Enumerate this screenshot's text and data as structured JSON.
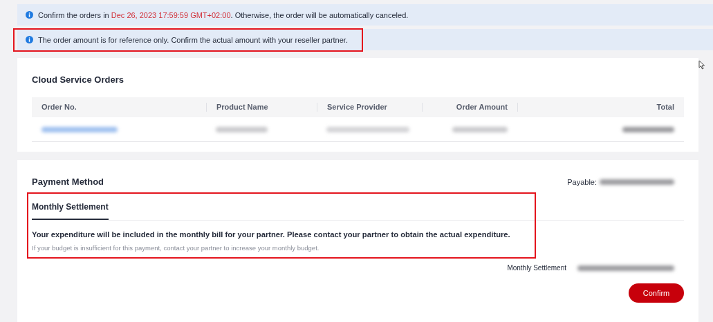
{
  "notices": [
    {
      "parts": [
        {
          "text": "Confirm the orders in ",
          "emphasis": false
        },
        {
          "text": "Dec 26, 2023 17:59:59 GMT+02:00",
          "emphasis": true
        },
        {
          "text": ". Otherwise, the order will be automatically canceled.",
          "emphasis": false
        }
      ],
      "highlighted": false
    },
    {
      "parts": [
        {
          "text": "The order amount is for reference only. Confirm the actual amount with your reseller partner.",
          "emphasis": false
        }
      ],
      "highlighted": true
    }
  ],
  "orders": {
    "title": "Cloud Service Orders",
    "columns": [
      "Order No.",
      "Product Name",
      "Service Provider",
      "Order Amount",
      "Total"
    ]
  },
  "payment": {
    "title": "Payment Method",
    "payable_label": "Payable:",
    "tabs": [
      {
        "label": "Monthly Settlement",
        "selected": true
      }
    ],
    "highlighted": true,
    "message": "Your expenditure will be included in the monthly bill for your partner. Please contact your partner to obtain the actual expenditure.",
    "hint": "If your budget is insufficient for this payment, contact your partner to increase your monthly budget.",
    "summary_label": "Monthly Settlement",
    "confirm": "Confirm"
  }
}
